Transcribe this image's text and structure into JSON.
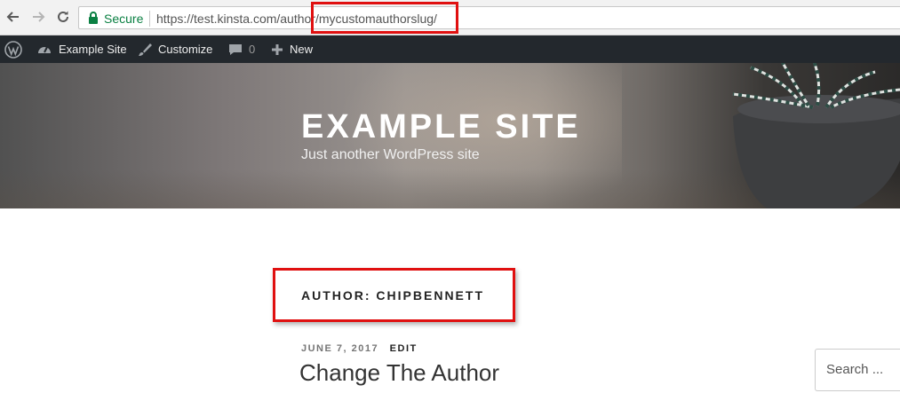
{
  "browser": {
    "secure_label": "Secure",
    "url_base": "https://test.kinsta.com/autho",
    "url_rest": "r/mycustomauthorslug/"
  },
  "admin_bar": {
    "site_name": "Example Site",
    "customize": "Customize",
    "comments_count": "0",
    "new_label": "New"
  },
  "header": {
    "site_title": "EXAMPLE SITE",
    "tagline": "Just another WordPress site"
  },
  "archive": {
    "title": "AUTHOR: CHIPBENNETT"
  },
  "post": {
    "date": "JUNE 7, 2017",
    "edit_label": "EDIT",
    "title": "Change The Author"
  },
  "sidebar": {
    "search_placeholder": "Search ..."
  },
  "colors": {
    "highlight": "#e01010",
    "admin_bar_bg": "#23282d",
    "secure_green": "#0b8043"
  }
}
